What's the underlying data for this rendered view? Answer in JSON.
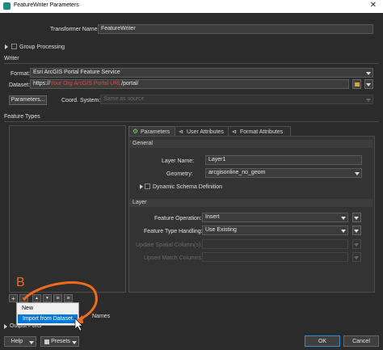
{
  "window": {
    "title": "FeatureWriter Parameters",
    "close": "✕"
  },
  "transformer_name": {
    "label": "Transformer Name:",
    "value": "FeatureWriter"
  },
  "group_processing": {
    "label": "Group Processing"
  },
  "writer": {
    "section": "Writer",
    "format_label": "Format:",
    "format_value": "Esri ArcGIS Portal Feature Service",
    "dataset_label": "Dataset:",
    "dataset_prefix": "https://",
    "dataset_highlight": "Your Org ArcGIS Portal URL",
    "dataset_suffix": "/portal/",
    "parameters_button": "Parameters...",
    "coord_label": "Coord. System:",
    "coord_placeholder": "Same as source"
  },
  "feature_types": {
    "section": "Feature Types",
    "tabs": [
      "Parameters",
      "User Attributes",
      "Format Attributes"
    ],
    "general": "General",
    "layer_name_label": "Layer Name:",
    "layer_name_value": "Layer1",
    "geometry_label": "Geometry:",
    "geometry_value": "arcgisonline_no_geom",
    "dynamic_schema": "Dynamic Schema Definition",
    "layer_section": "Layer",
    "feature_operation_label": "Feature Operation:",
    "feature_operation_value": "Insert",
    "feature_type_handling_label": "Feature Type Handling:",
    "feature_type_handling_value": "Use Existing",
    "update_spatial_label": "Update Spatial Column(s):",
    "upsert_match_label": "Upsert Match Columns:"
  },
  "list_buttons": {
    "add": "+",
    "remove": "−",
    "up": "▲",
    "down": "▼",
    "top": "≡",
    "bottom": "≡"
  },
  "context_menu": {
    "items": [
      "New",
      "Import from Dataset..."
    ]
  },
  "annotation": {
    "letter": "B",
    "color": "#f26b1d"
  },
  "partial_rows": {
    "names": "Names",
    "output_ports": "Output Ports"
  },
  "footer": {
    "help": "Help",
    "presets": "Presets",
    "ok": "OK",
    "cancel": "Cancel"
  }
}
